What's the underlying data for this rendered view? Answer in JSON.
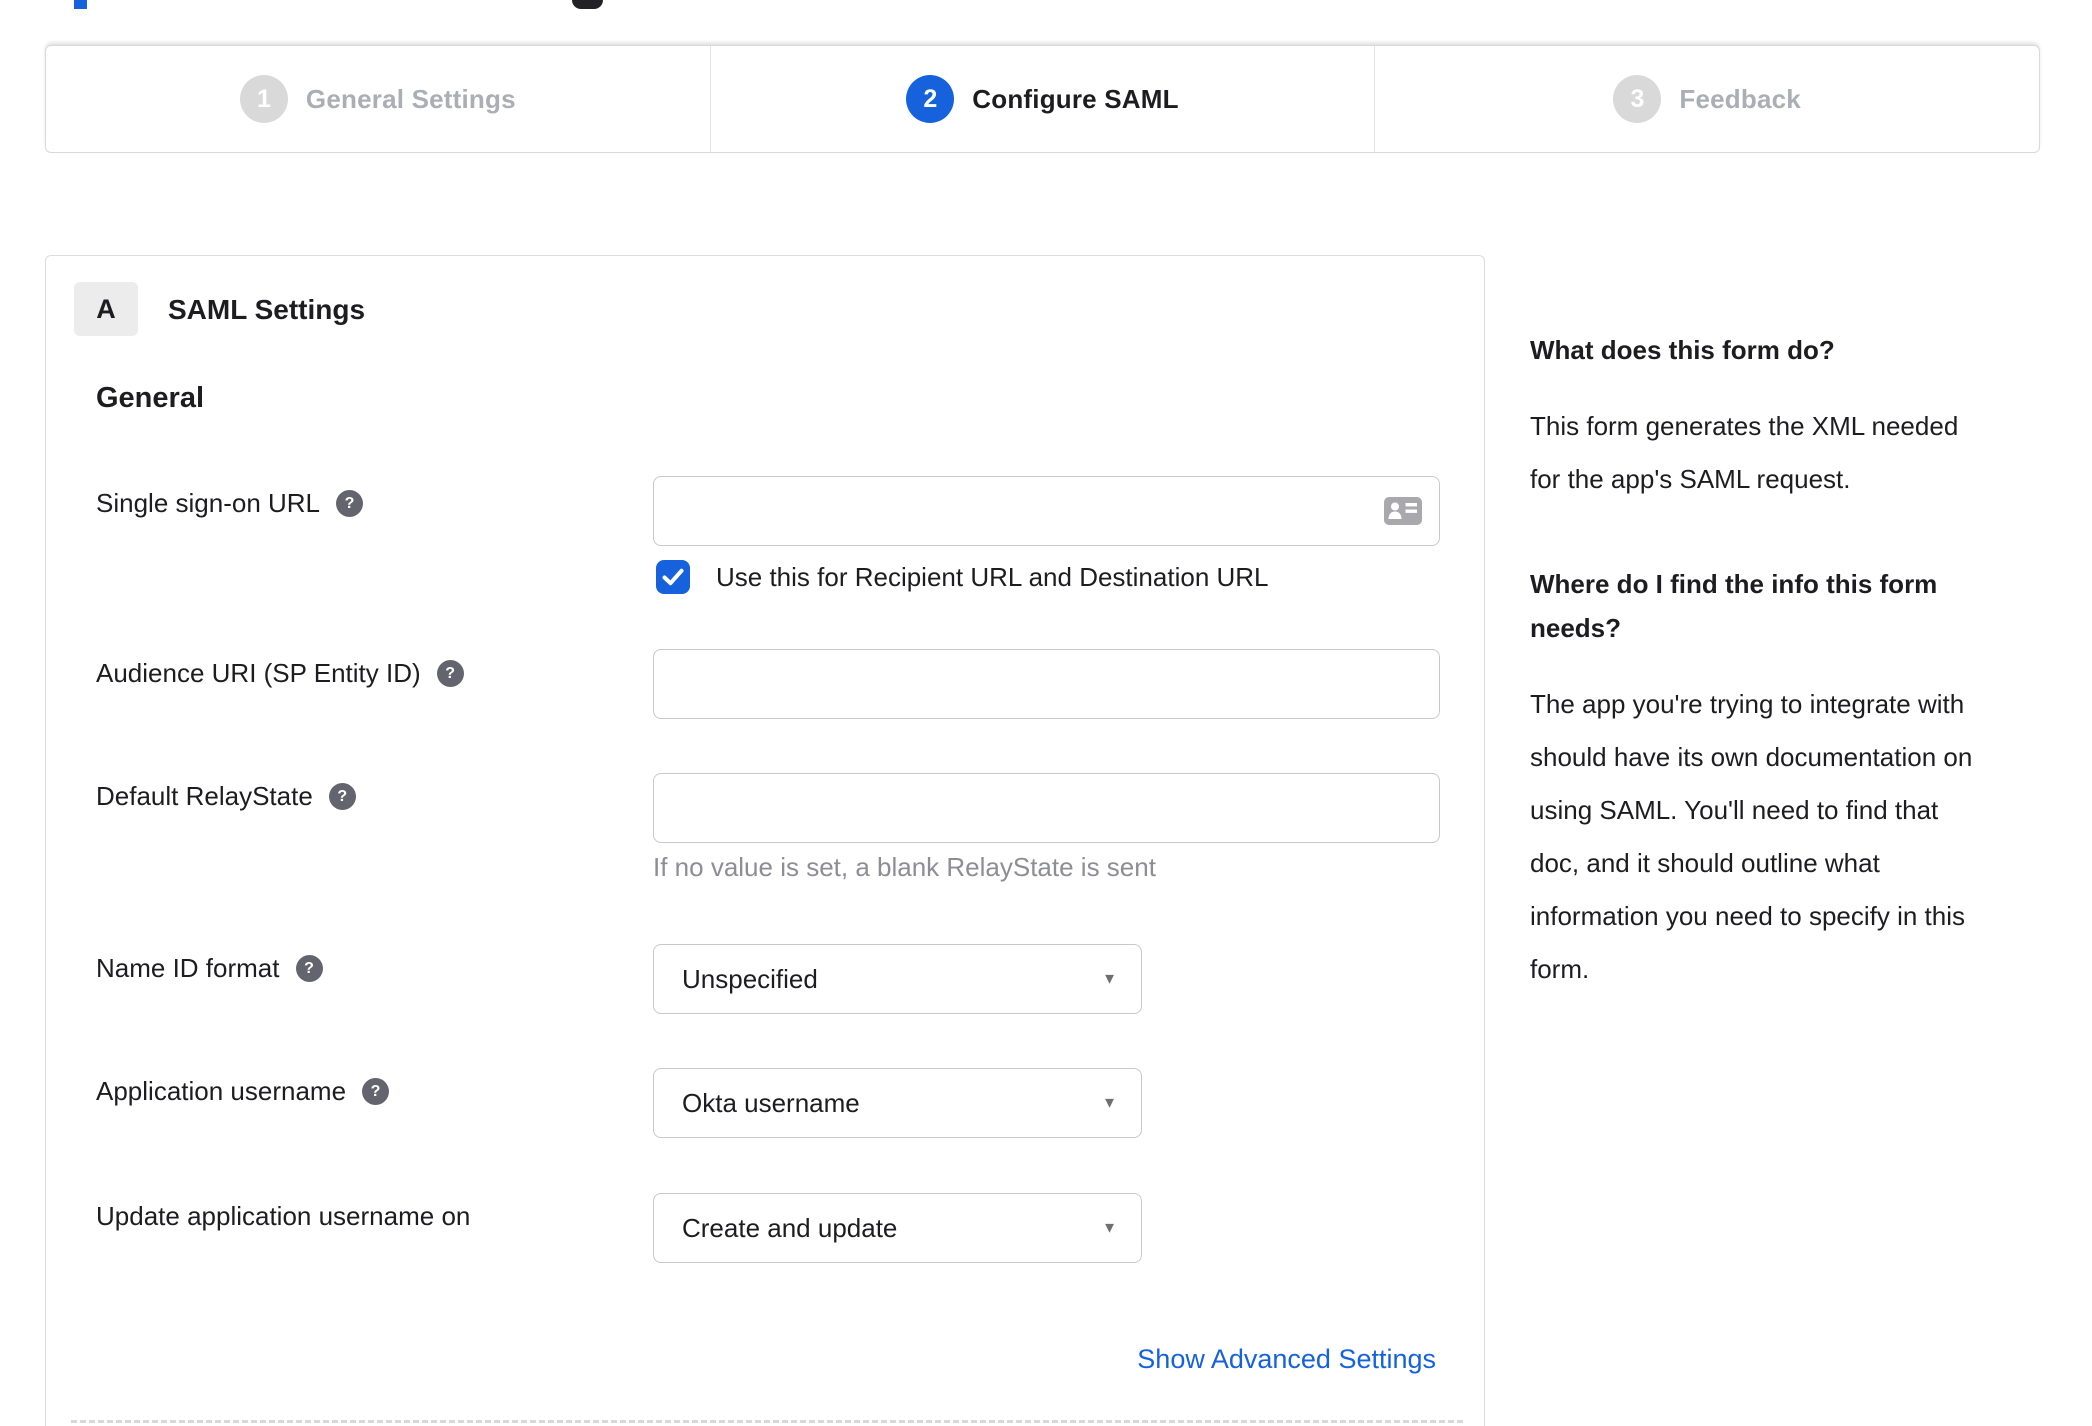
{
  "colors": {
    "accent_blue": "#1662dd",
    "text_dark": "#1d1d21",
    "inactive_gray": "#abaeb4",
    "step_circle_gray": "#d9d9d9",
    "input_border": "#c9c9c9",
    "hint_gray": "#8d8d95"
  },
  "icons": {
    "help_glyph": "?",
    "dropdown_arrow_glyph": "▼"
  },
  "stepper": {
    "steps": [
      {
        "number": "1",
        "label": "General Settings",
        "state": "inactive"
      },
      {
        "number": "2",
        "label": "Configure SAML",
        "state": "active"
      },
      {
        "number": "3",
        "label": "Feedback",
        "state": "inactive"
      }
    ]
  },
  "panel": {
    "badge": "A",
    "title": "SAML Settings",
    "section_heading": "General"
  },
  "form": {
    "sso": {
      "label": "Single sign-on URL",
      "value": "",
      "checkbox_label": "Use this for Recipient URL and Destination URL",
      "checkbox_checked": true
    },
    "audience": {
      "label": "Audience URI (SP Entity ID)",
      "value": ""
    },
    "relay_state": {
      "label": "Default RelayState",
      "value": "",
      "hint": "If no value is set, a blank RelayState is sent"
    },
    "name_id_format": {
      "label": "Name ID format",
      "value": "Unspecified"
    },
    "application_username": {
      "label": "Application username",
      "value": "Okta username"
    },
    "update_application_username_on": {
      "label": "Update application username on",
      "value": "Create and update"
    },
    "advanced_link": "Show Advanced Settings"
  },
  "sidebar": {
    "q1": "What does this form do?",
    "a1": "This form generates the XML needed\nfor the app's SAML request.",
    "q2": "Where do I find the info this form\nneeds?",
    "a2": "The app you're trying to integrate with\nshould have its own documentation on\nusing SAML. You'll need to find that\ndoc, and it should outline what\ninformation you need to specify in this\nform."
  }
}
